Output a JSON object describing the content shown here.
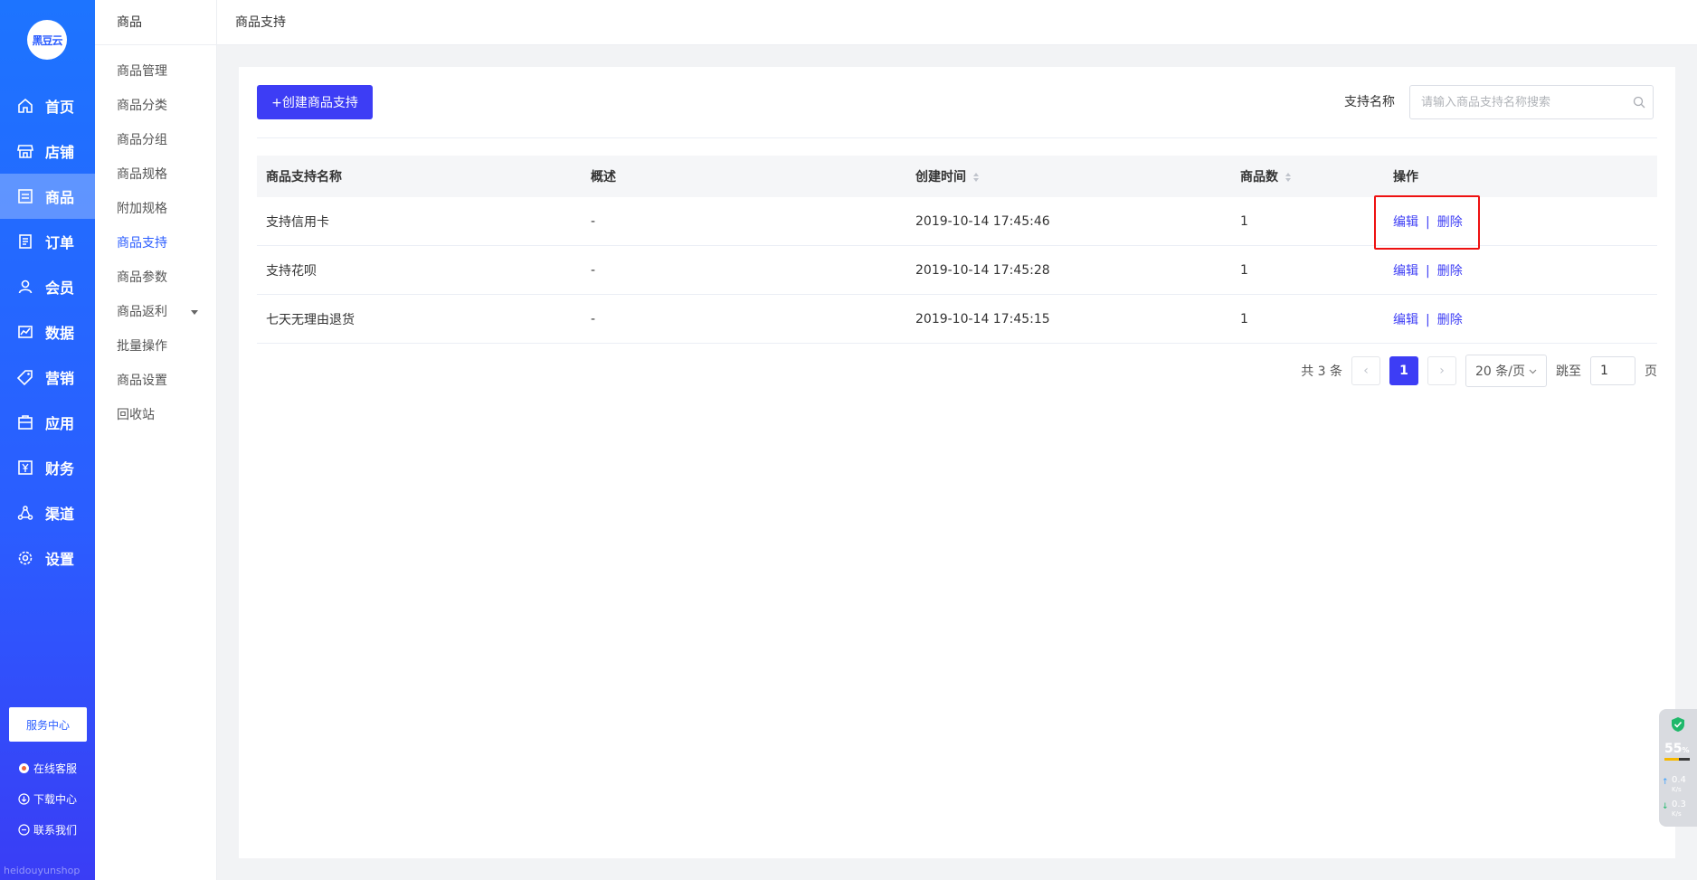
{
  "logo": {
    "text": "黑豆云"
  },
  "nav": [
    {
      "label": "首页",
      "icon": "home-icon"
    },
    {
      "label": "店铺",
      "icon": "store-icon"
    },
    {
      "label": "商品",
      "icon": "goods-icon"
    },
    {
      "label": "订单",
      "icon": "order-icon"
    },
    {
      "label": "会员",
      "icon": "member-icon"
    },
    {
      "label": "数据",
      "icon": "chart-icon"
    },
    {
      "label": "营销",
      "icon": "tag-icon"
    },
    {
      "label": "应用",
      "icon": "app-icon"
    },
    {
      "label": "财务",
      "icon": "yuan-icon"
    },
    {
      "label": "渠道",
      "icon": "channel-icon"
    },
    {
      "label": "设置",
      "icon": "gear-icon"
    }
  ],
  "service_center": "服务中心",
  "footer_links": {
    "online_service": "在线客服",
    "download": "下载中心",
    "contact": "联系我们"
  },
  "brand": "heidouyunshop",
  "subnav": {
    "title": "商品",
    "items": [
      "商品管理",
      "商品分类",
      "商品分组",
      "商品规格",
      "附加规格",
      "商品支持",
      "商品参数",
      "商品返利",
      "批量操作",
      "商品设置",
      "回收站"
    ]
  },
  "breadcrumb": "商品支持",
  "toolbar": {
    "create_label": "+创建商品支持",
    "search_label": "支持名称",
    "search_placeholder": "请输入商品支持名称搜索"
  },
  "table": {
    "headers": [
      "商品支持名称",
      "概述",
      "创建时间",
      "商品数",
      "操作"
    ],
    "rows": [
      {
        "name": "支持信用卡",
        "desc": "-",
        "time": "2019-10-14 17:45:46",
        "count": "1"
      },
      {
        "name": "支持花呗",
        "desc": "-",
        "time": "2019-10-14 17:45:28",
        "count": "1"
      },
      {
        "name": "七天无理由退货",
        "desc": "-",
        "time": "2019-10-14 17:45:15",
        "count": "1"
      }
    ],
    "actions": {
      "edit": "编辑",
      "delete": "删除",
      "separator": "|"
    }
  },
  "pagination": {
    "total": "共 3 条",
    "current": "1",
    "page_size": "20 条/页",
    "jump_label": "跳至",
    "jump_value": "1",
    "page_suffix": "页"
  },
  "widget": {
    "percent": "55",
    "percent_unit": "%",
    "up_speed": "0.4",
    "down_speed": "0.3",
    "speed_unit": "K/s"
  },
  "colors": {
    "primary": "#3d3df5",
    "sidebar": "#2b5dff",
    "highlight": "#ee1111"
  }
}
